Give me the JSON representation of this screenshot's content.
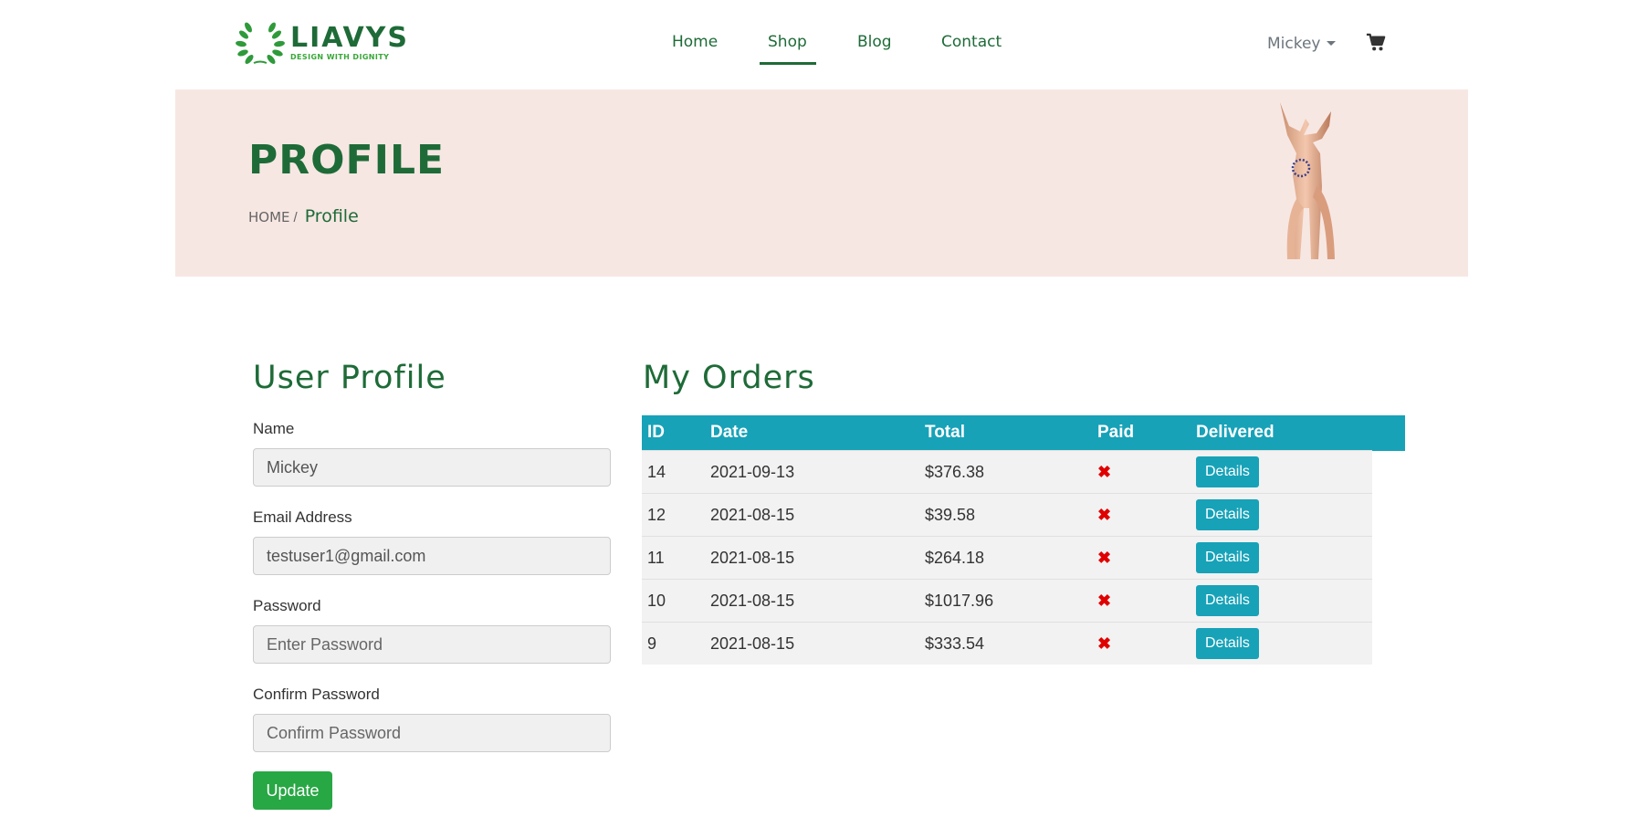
{
  "brand": {
    "name": "LIAVYS",
    "tagline": "DESIGN WITH DIGNITY",
    "primary_color": "#1e6b38"
  },
  "nav": {
    "items": [
      "Home",
      "Shop",
      "Blog",
      "Contact"
    ],
    "active": "Shop"
  },
  "user_menu": {
    "name": "Mickey"
  },
  "banner": {
    "title": "PROFILE",
    "breadcrumb_home": "HOME",
    "breadcrumb_sep": "/",
    "breadcrumb_current": "Profile"
  },
  "profile": {
    "title": "User Profile",
    "name_label": "Name",
    "name_value": "Mickey",
    "email_label": "Email Address",
    "email_value": "testuser1@gmail.com",
    "password_label": "Password",
    "password_placeholder": "Enter Password",
    "confirm_label": "Confirm Password",
    "confirm_placeholder": "Confirm Password",
    "update_label": "Update"
  },
  "orders": {
    "title": "My Orders",
    "headers": [
      "ID",
      "Date",
      "Total",
      "Paid",
      "Delivered"
    ],
    "details_label": "Details",
    "rows": [
      {
        "id": "14",
        "date": "2021-09-13",
        "total": "$376.38",
        "paid": "x-icon"
      },
      {
        "id": "12",
        "date": "2021-08-15",
        "total": "$39.58",
        "paid": "x-icon"
      },
      {
        "id": "11",
        "date": "2021-08-15",
        "total": "$264.18",
        "paid": "x-icon"
      },
      {
        "id": "10",
        "date": "2021-08-15",
        "total": "$1017.96",
        "paid": "x-icon"
      },
      {
        "id": "9",
        "date": "2021-08-15",
        "total": "$333.54",
        "paid": "x-icon"
      }
    ]
  }
}
